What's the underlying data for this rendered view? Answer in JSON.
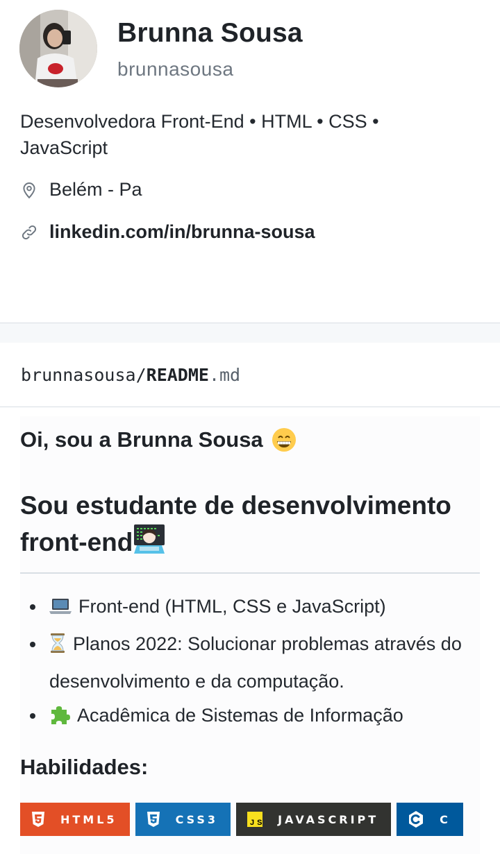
{
  "profile": {
    "name": "Brunna Sousa",
    "login": "brunnasousa",
    "bio": "Desenvolvedora Front-End • HTML • CSS • JavaScript",
    "location": "Belém - Pa",
    "website": "linkedin.com/in/brunna-sousa"
  },
  "readme": {
    "owner": "brunnasousa",
    "separator": "/",
    "file": "README",
    "ext": ".md"
  },
  "content": {
    "greeting": "Oi, sou a Brunna Sousa",
    "headline": "Sou estudante de desenvolvimento front-end",
    "bullets": [
      {
        "icon": "laptop-icon",
        "text": "Front-end (HTML, CSS e JavaScript)"
      },
      {
        "icon": "hourglass-icon",
        "text": "Planos 2022: Solucionar problemas através do desenvolvimento e da computação."
      },
      {
        "icon": "puzzle-icon",
        "text": "Acadêmica de Sistemas de Informação"
      }
    ],
    "skills_title": "Habilidades:",
    "badges": [
      {
        "label": "HTML5",
        "color": "#E34F26"
      },
      {
        "label": "CSS3",
        "color": "#1572B6"
      },
      {
        "label": "JAVASCRIPT",
        "color": "#323330"
      },
      {
        "label": "C",
        "color": "#00599C"
      }
    ]
  },
  "colors": {
    "text": "#1f2328",
    "muted": "#6e7781",
    "border": "#d8dee4"
  }
}
